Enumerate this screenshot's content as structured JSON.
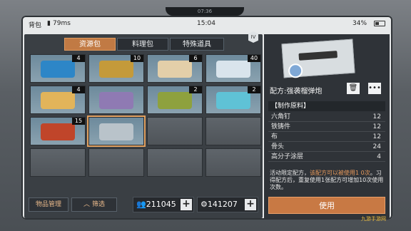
{
  "status_bar": {
    "title": "背包",
    "signal": "79ms",
    "time": "15:04",
    "battery": "34%"
  },
  "notch_time": "07:36",
  "tabs": [
    {
      "label": "资源包",
      "active": true
    },
    {
      "label": "料理包",
      "active": false
    },
    {
      "label": "特殊道具",
      "active": false
    }
  ],
  "tier_badge": "IV",
  "inventory": [
    {
      "name": "syringe",
      "count": "4",
      "color": "#2d86c7"
    },
    {
      "name": "canned-food",
      "count": "10",
      "color": "#c49a3a"
    },
    {
      "name": "bandage-roll",
      "count": "6",
      "color": "#e3cfa9"
    },
    {
      "name": "plastic-bag",
      "count": "40",
      "color": "#d9e4ec"
    },
    {
      "name": "paper-scroll",
      "count": "4",
      "color": "#e2b45a"
    },
    {
      "name": "blueprint-purple",
      "count": "",
      "color": "#8f7ab3"
    },
    {
      "name": "green-tube",
      "count": "2",
      "color": "#8ea13e"
    },
    {
      "name": "blue-tarp",
      "count": "2",
      "color": "#5fc2d6"
    },
    {
      "name": "red-herb",
      "count": "15",
      "color": "#c0452a"
    },
    {
      "name": "blueprint-weapon",
      "count": "",
      "color": "#b9c3ca"
    }
  ],
  "bottom": {
    "manage_label": "物品管理",
    "filter_label": "筛选",
    "currency1": "211045",
    "currency2": "141207"
  },
  "detail": {
    "title": "配方:强袭榴弹炮",
    "materials_header": "【制作原料】",
    "materials": [
      {
        "name": "六角钉",
        "qty": "12"
      },
      {
        "name": "铁铸件",
        "qty": "12"
      },
      {
        "name": "布",
        "qty": "12"
      },
      {
        "name": "骨头",
        "qty": "24"
      },
      {
        "name": "高分子涂层",
        "qty": "4"
      }
    ],
    "desc_part1": "活动限定配方，",
    "desc_part2": "该配方可以被使用1 0次",
    "desc_part3": "。习得配方后，重复使用1张配方可增加10次使用次数。",
    "use_label": "使用"
  },
  "watermark": "九游手游网"
}
